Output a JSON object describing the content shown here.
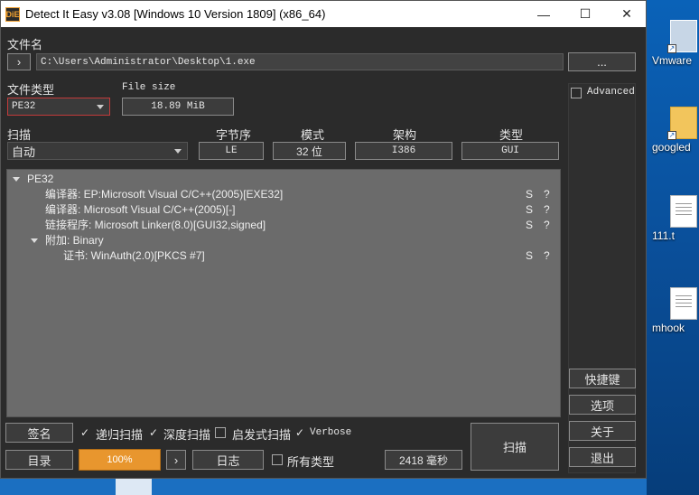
{
  "window": {
    "title": "Detect It Easy v3.08 [Windows 10 Version 1809] (x86_64)",
    "app_icon": "DiE",
    "minimize": "—",
    "maximize": "☐",
    "close": "✕"
  },
  "file": {
    "label": "文件名",
    "expand": "›",
    "path": "C:\\Users\\Administrator\\Desktop\\1.exe",
    "browse": "..."
  },
  "filetype": {
    "label": "文件类型",
    "value": "PE32",
    "size_label": "File size",
    "size_value": "18.89 MiB"
  },
  "advanced": {
    "label": "Advanced",
    "checked": false
  },
  "scan": {
    "label": "扫描",
    "mode": "自动",
    "endian_label": "字节序",
    "endian": "LE",
    "mode_label": "模式",
    "bits": "32 位",
    "arch_label": "架构",
    "arch": "I386",
    "type_label": "类型",
    "type": "GUI"
  },
  "results": {
    "root": "PE32",
    "rows": [
      {
        "text": "编译器: EP:Microsoft Visual C/C++(2005)[EXE32]",
        "s": "S",
        "q": "?"
      },
      {
        "text": "编译器: Microsoft Visual C/C++(2005)[-]",
        "s": "S",
        "q": "?"
      },
      {
        "text": "链接程序: Microsoft Linker(8.0)[GUI32,signed]",
        "s": "S",
        "q": "?"
      },
      {
        "text": "附加: Binary",
        "s": "",
        "q": ""
      },
      {
        "text": "证书: WinAuth(2.0)[PKCS #7]",
        "s": "S",
        "q": "?"
      }
    ]
  },
  "bottom": {
    "signature": "签名",
    "recursive": "递归扫描",
    "deep": "深度扫描",
    "heuristic": "启发式扫描",
    "verbose": "Verbose",
    "directory": "目录",
    "progress": "100%",
    "next": "›",
    "log": "日志",
    "all_types": "所有类型",
    "elapsed": "2418 毫秒",
    "scan_button": "扫描"
  },
  "side": {
    "shortcuts": "快捷键",
    "options": "选项",
    "about": "关于",
    "exit": "退出"
  },
  "desktop": {
    "icon1": "Vmware",
    "icon2": "googled",
    "icon3": "111.t",
    "icon4": "mhook"
  },
  "colors": {
    "accent_orange": "#e8962e",
    "window_bg": "#2b2b2b",
    "tree_bg": "#6b6b6b"
  }
}
